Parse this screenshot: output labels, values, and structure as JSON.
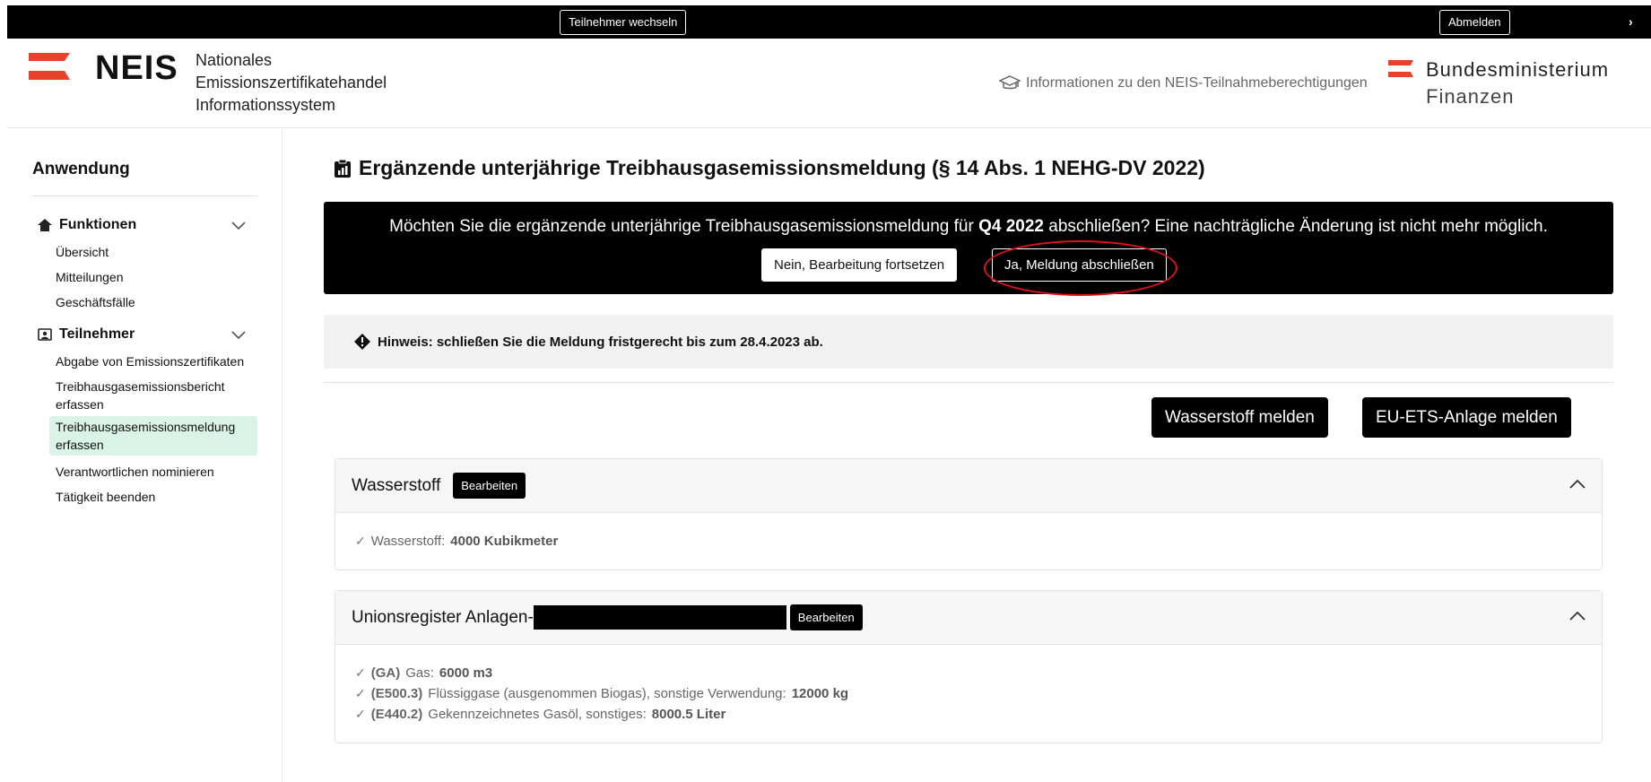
{
  "topbar": {
    "switch_label": "Teilnehmer wechseln",
    "logout_label": "Abmelden",
    "chevron": "›"
  },
  "header": {
    "logo_word": "NEIS",
    "logo_sub": [
      "Nationales",
      "Emissionszertifikatehandel",
      "Informationssystem"
    ],
    "info_link": "Informationen zu den NEIS-Teilnahmeberechtigungen",
    "ministry": [
      "Bundesministerium",
      "Finanzen"
    ],
    "brand_red": "#e8412c"
  },
  "sidebar": {
    "title": "Anwendung",
    "groups": [
      {
        "label": "Funktionen",
        "items": [
          "Übersicht",
          "Mitteilungen",
          "Geschäftsfälle"
        ]
      },
      {
        "label": "Teilnehmer",
        "items": [
          "Abgabe von Emissionszertifikaten",
          "Treibhausgasemissionsbericht erfassen",
          "Treibhausgasemissionsmeldung erfassen",
          "Verantwortlichen nominieren",
          "Tätigkeit beenden"
        ]
      }
    ],
    "active_color": "#d9f3e7"
  },
  "main": {
    "title": "Ergänzende unterjährige Treibhausgasemissionsmeldung (§ 14 Abs. 1 NEHG-DV 2022)",
    "confirm": {
      "text_before": "Möchten Sie die ergänzende unterjährige Treibhausgasemissionsmeldung für ",
      "text_bold": "Q4 2022",
      "text_after": " abschließen? Eine nachträgliche Änderung ist nicht mehr möglich.",
      "no_label": "Nein, Bearbeitung fortsetzen",
      "yes_label": "Ja, Meldung abschließen"
    },
    "hint": "Hinweis: schließen Sie die Meldung fristgerecht bis zum 28.4.2023 ab.",
    "buttons": {
      "hydrogen": "Wasserstoff melden",
      "ets": "EU-ETS-Anlage melden"
    },
    "panels": [
      {
        "title": "Wasserstoff",
        "edit_label": "Bearbeiten",
        "rows": [
          {
            "code": "",
            "label": "Wasserstoff:",
            "value": "4000 Kubikmeter"
          }
        ]
      },
      {
        "title": "Unionsregister Anlagen-",
        "edit_label": "Bearbeiten",
        "rows": [
          {
            "code": "(GA)",
            "label": "Gas:",
            "value": "6000 m3"
          },
          {
            "code": "(E500.3)",
            "label": "Flüssiggase (ausgenommen Biogas), sonstige Verwendung:",
            "value": "12000 kg"
          },
          {
            "code": "(E440.2)",
            "label": "Gekennzeichnetes Gasöl, sonstiges:",
            "value": "8000.5 Liter"
          }
        ]
      }
    ]
  },
  "annotation_color": "#e0121b"
}
